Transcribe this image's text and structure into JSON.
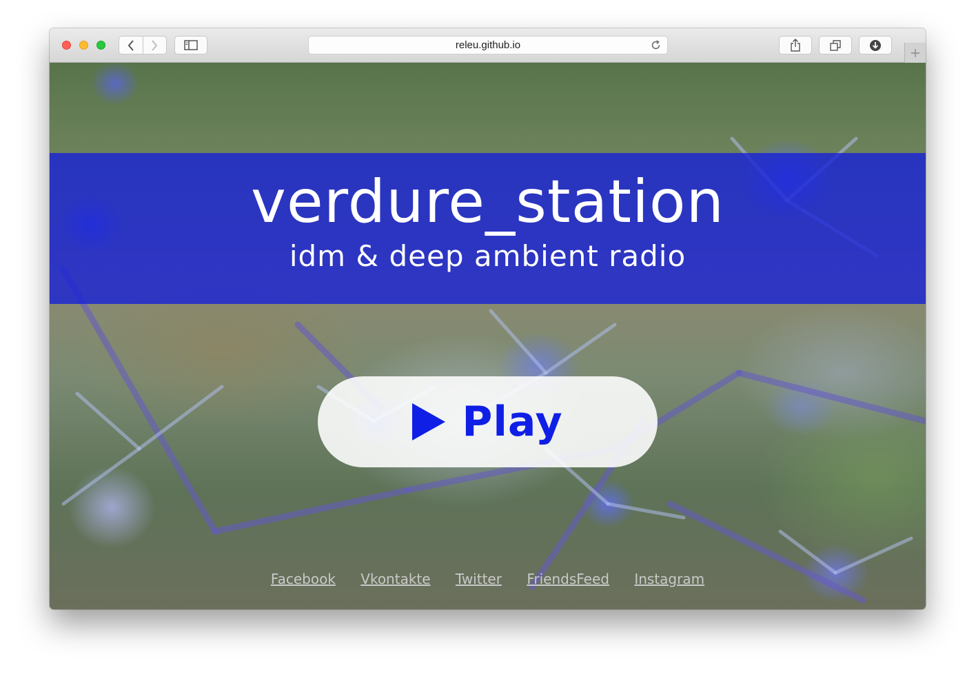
{
  "browser": {
    "url": "releu.github.io",
    "icons": {
      "back": "chevron-left-icon",
      "forward": "chevron-right-icon",
      "sidebar": "sidebar-icon",
      "reload": "reload-icon",
      "share": "share-icon",
      "tabs": "tabs-overview-icon",
      "downloads": "download-icon",
      "new_tab": "plus-icon"
    }
  },
  "page": {
    "title": "verdure_station",
    "subtitle": "idm & deep ambient radio",
    "play_label": "Play",
    "play_icon": "play-icon",
    "colors": {
      "banner": "#1620d7",
      "play_text": "#0f1fe6",
      "link": "#d4d4d4"
    },
    "links": [
      "Facebook",
      "Vkontakte",
      "Twitter",
      "FriendsFeed",
      "Instagram"
    ]
  }
}
